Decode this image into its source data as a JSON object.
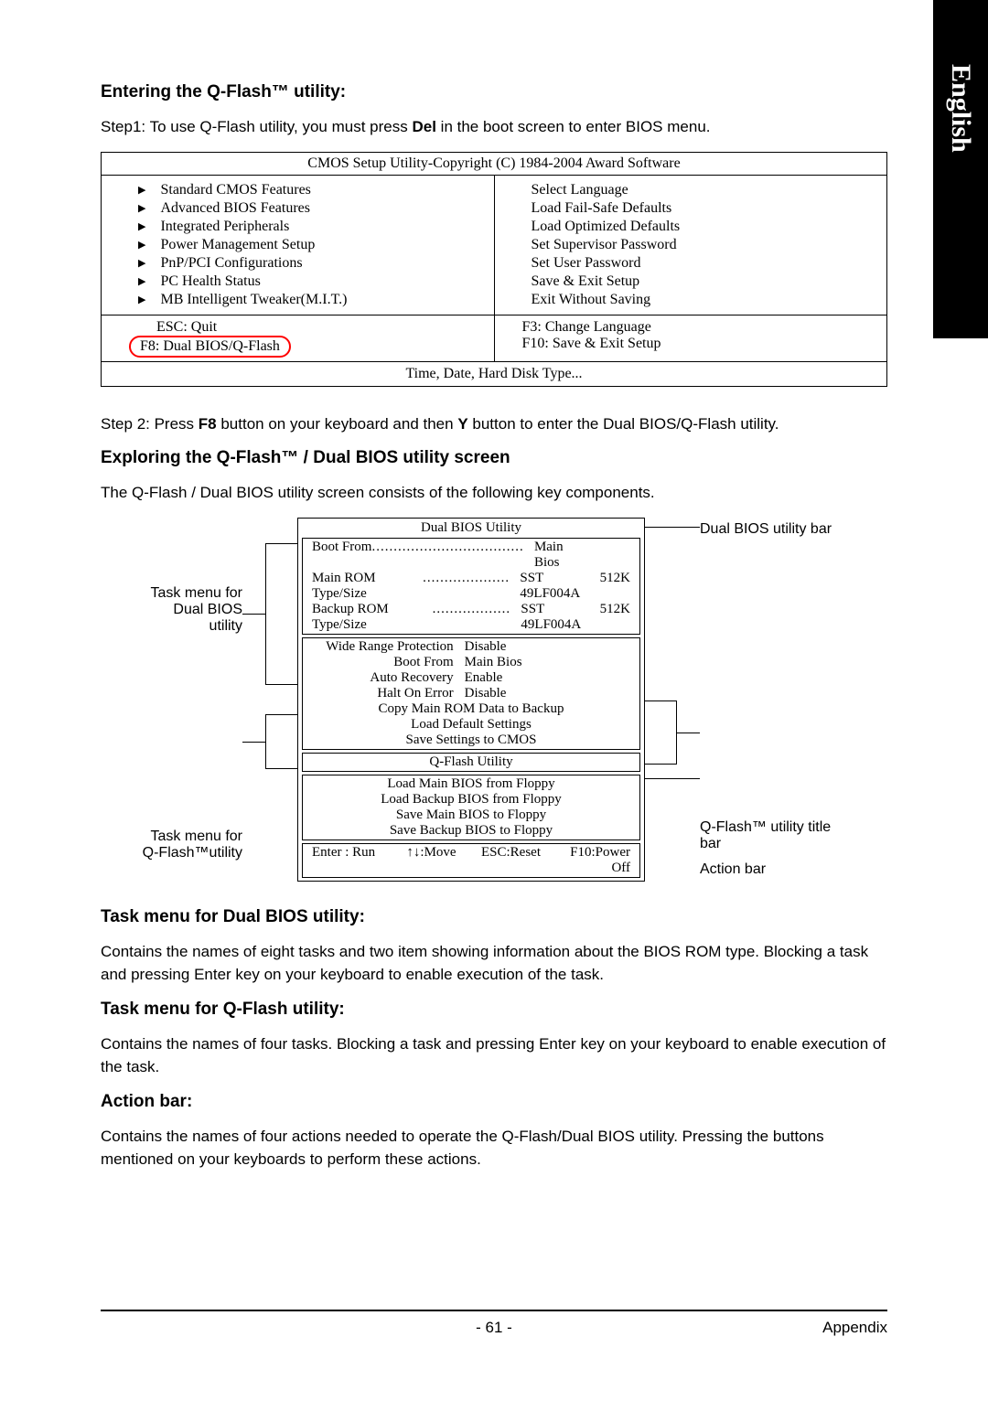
{
  "sideTab": "English",
  "h1": "Entering the Q-Flash™ utility:",
  "step1_pre": "Step1: To use Q-Flash utility, you must press ",
  "step1_bold": "Del",
  "step1_post": " in the boot screen to enter BIOS menu.",
  "cmos": {
    "title": "CMOS Setup Utility-Copyright (C) 1984-2004 Award Software",
    "left": [
      "Standard CMOS Features",
      "Advanced BIOS Features",
      "Integrated Peripherals",
      "Power Management Setup",
      "PnP/PCI Configurations",
      "PC Health Status",
      "MB Intelligent Tweaker(M.I.T.)"
    ],
    "right": [
      "Select Language",
      "Load Fail-Safe Defaults",
      "Load Optimized Defaults",
      "Set Supervisor Password",
      "Set User Password",
      "Save & Exit Setup",
      "Exit Without Saving"
    ],
    "foot_l1": "ESC: Quit",
    "foot_l2": "F8: Dual BIOS/Q-Flash",
    "foot_r1": "F3: Change Language",
    "foot_r2": "F10: Save & Exit Setup",
    "helper": "Time, Date, Hard Disk Type..."
  },
  "step2_pre": "Step 2: Press ",
  "step2_b1": "F8",
  "step2_mid": " button on your keyboard and then ",
  "step2_b2": "Y",
  "step2_post": " button to enter the Dual BIOS/Q-Flash utility.",
  "h2": "Exploring the Q-Flash™ / Dual BIOS utility screen",
  "h2_sub": "The Q-Flash / Dual BIOS utility screen consists of the following key components.",
  "diagram": {
    "l1a": "Task menu for",
    "l1b": "Dual BIOS",
    "l1c": "utility",
    "l2a": "Task menu for",
    "l2b": "Q-Flash™utility",
    "r1": "Dual BIOS utility bar",
    "r2a": "Q-Flash™ utility title",
    "r2b": "bar",
    "r3": "Action bar"
  },
  "util": {
    "title": "Dual BIOS Utility",
    "top": [
      {
        "label": "Boot From",
        "dots": "...................................",
        "val": "Main Bios",
        "sz": ""
      },
      {
        "label": "Main ROM Type/Size",
        "dots": "....................",
        "val": "SST 49LF004A",
        "sz": "512K"
      },
      {
        "label": "Backup ROM Type/Size",
        "dots": "..................",
        "val": "SST 49LF004A",
        "sz": "512K"
      }
    ],
    "mid_pairs": [
      {
        "l": "Wide Range Protection",
        "v": "Disable"
      },
      {
        "l": "Boot From",
        "v": "Main Bios"
      },
      {
        "l": "Auto Recovery",
        "v": "Enable"
      },
      {
        "l": "Halt On Error",
        "v": "Disable"
      }
    ],
    "mid_center": [
      "Copy Main ROM Data to Backup",
      "Load Default Settings",
      "Save Settings to CMOS"
    ],
    "qtitle": "Q-Flash Utility",
    "qlist": [
      "Load Main BIOS from Floppy",
      "Load Backup BIOS from Floppy",
      "Save Main BIOS to Floppy",
      "Save Backup BIOS to Floppy"
    ],
    "action": [
      "Enter : Run",
      "↑↓:Move",
      "ESC:Reset",
      "F10:Power Off"
    ]
  },
  "h3": "Task menu for Dual BIOS utility:",
  "p3": "Contains the names of eight tasks and two item showing information about the BIOS ROM type. Blocking a task and pressing Enter key on your keyboard to enable execution of the task.",
  "h4": "Task menu for Q-Flash utility:",
  "p4": "Contains the names of four tasks. Blocking a task and pressing Enter key on your keyboard to enable execution of the task.",
  "h5": "Action bar:",
  "p5": "Contains the names of four actions needed to operate the Q-Flash/Dual BIOS utility. Pressing the buttons mentioned on your keyboards to perform these actions.",
  "footer": {
    "page": "- 61 -",
    "section": "Appendix"
  }
}
